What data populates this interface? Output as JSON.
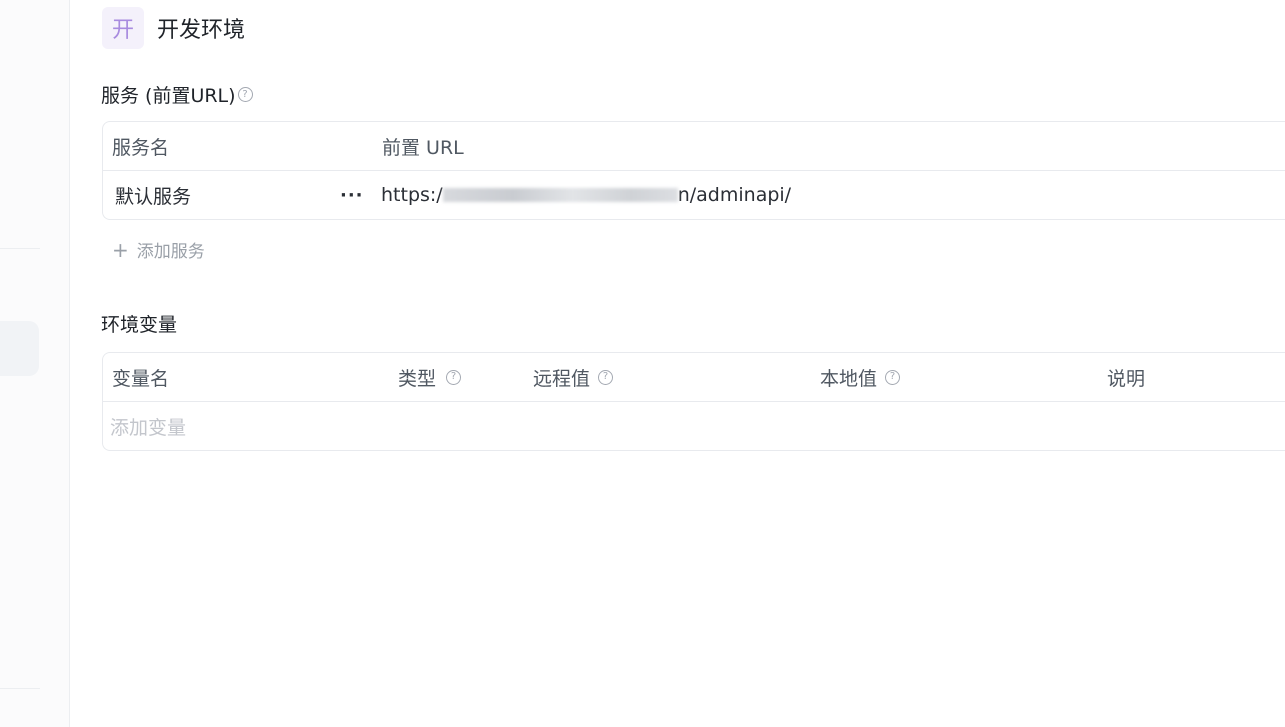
{
  "environment": {
    "avatar_char": "开",
    "name": "开发环境"
  },
  "services_section": {
    "title": "服务 (前置URL)",
    "columns": [
      "服务名",
      "前置 URL"
    ],
    "rows": [
      {
        "name": "默认服务",
        "url_prefix": "https:/",
        "url_suffix": "n/adminapi/"
      }
    ],
    "add_label": "添加服务"
  },
  "variables_section": {
    "title": "环境变量",
    "columns": [
      "变量名",
      "类型",
      "远程值",
      "本地值",
      "说明"
    ],
    "add_placeholder": "添加变量"
  },
  "icons": {
    "help": "question-circle-icon",
    "more": "more-horizontal-icon",
    "add": "plus-icon"
  },
  "colors": {
    "avatar_bg": "#f4f1fb",
    "avatar_fg": "#a88bdf",
    "border": "#e8eaee"
  }
}
